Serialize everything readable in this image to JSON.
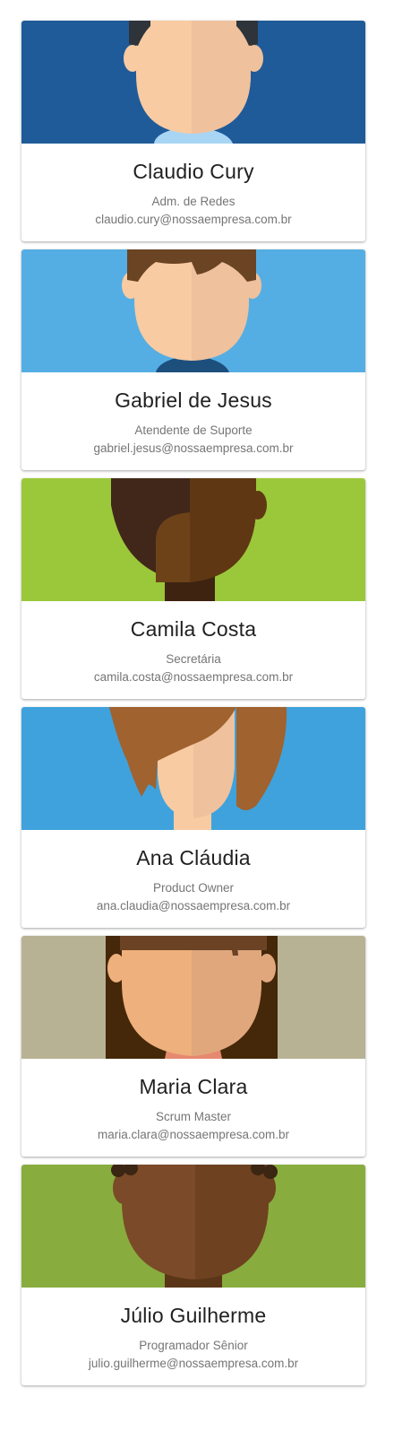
{
  "contacts": [
    {
      "name": "Claudio Cury",
      "role": "Adm. de Redes",
      "email": "claudio.cury@nossaempresa.com.br",
      "avatar": {
        "bg": "#1f5b99",
        "skin": "#f8cba2",
        "skin_shade": "#efc19c",
        "hair": "#2e343a",
        "shirt": "#a9d5f5"
      }
    },
    {
      "name": "Gabriel de Jesus",
      "role": "Atendente de Suporte",
      "email": "gabriel.jesus@nossaempresa.com.br",
      "avatar": {
        "bg": "#55aee3",
        "skin": "#f8cba2",
        "skin_shade": "#efc19c",
        "hair": "#6b4424",
        "shirt": "#1d4f7d"
      }
    },
    {
      "name": "Camila Costa",
      "role": "Secretária",
      "email": "camila.costa@nossaempresa.com.br",
      "avatar": {
        "bg": "#9bc83a",
        "skin": "#6e4218",
        "skin_shade": "#5f3813",
        "hair": "#412719",
        "shirt": "#3e2311"
      }
    },
    {
      "name": "Ana Cláudia",
      "role": "Product Owner",
      "email": "ana.claudia@nossaempresa.com.br",
      "avatar": {
        "bg": "#3fa2dc",
        "skin": "#f8cba2",
        "skin_shade": "#efc19c",
        "hair": "#a0622e",
        "shirt": "#f8cba2"
      }
    },
    {
      "name": "Maria Clara",
      "role": "Scrum Master",
      "email": "maria.clara@nossaempresa.com.br",
      "avatar": {
        "bg": "#b8b294",
        "skin": "#eeb07d",
        "skin_shade": "#e0a77d",
        "hair": "#452809",
        "shirt": "#e58970"
      }
    },
    {
      "name": "Júlio Guilherme",
      "role": "Programador Sênior",
      "email": "julio.guilherme@nossaempresa.com.br",
      "avatar": {
        "bg": "#88ad3e",
        "skin": "#7b4a28",
        "skin_shade": "#6e4121",
        "hair": "#3b2513",
        "shirt": "#5a3518"
      }
    }
  ]
}
